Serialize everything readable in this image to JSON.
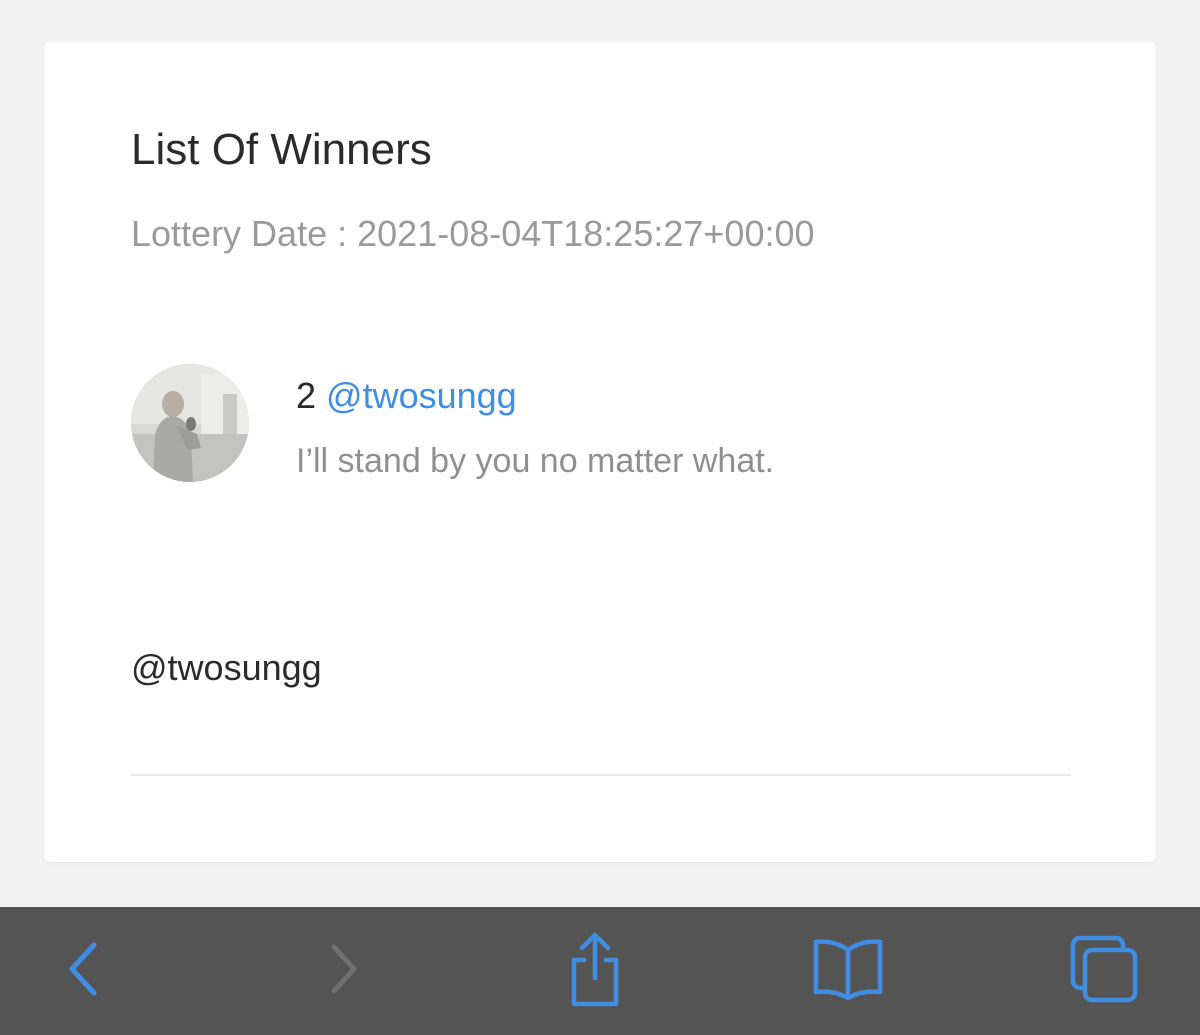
{
  "card": {
    "title": "List Of Winners",
    "lottery_date_label": "Lottery Date",
    "lottery_date_separator": " : ",
    "lottery_date_value": "2021-08-04T18:25:27+00:00"
  },
  "winner": {
    "rank": "2",
    "handle": "@twosungg",
    "comment": "I’ll stand by you no matter what."
  },
  "footer_handle": "@twosungg",
  "toolbar": {
    "back_icon": "chevron-left-icon",
    "forward_icon": "chevron-right-icon",
    "share_icon": "share-icon",
    "bookmarks_icon": "book-icon",
    "tabs_icon": "tabs-icon"
  },
  "colors": {
    "accent": "#3f8ee3",
    "toolbar_bg": "#545454",
    "toolbar_icon_active": "#3f8ee3",
    "toolbar_icon_disabled": "#707070",
    "title_text": "#2b2b2b",
    "muted_text": "#9a9a9a"
  }
}
